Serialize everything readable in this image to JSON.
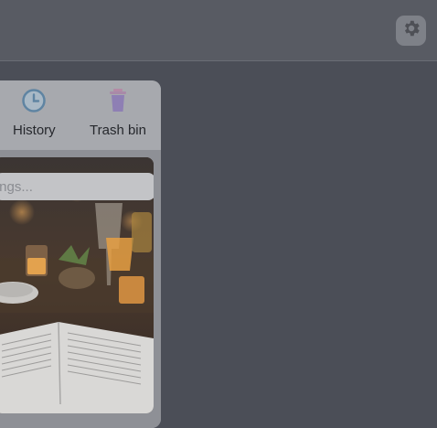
{
  "header": {
    "settings_icon": "gear-icon"
  },
  "tabs": [
    {
      "label": "History",
      "icon": "clock-icon",
      "color": "#6a8ca6"
    },
    {
      "label": "Trash bin",
      "icon": "trash-bin-icon",
      "color": "#8a7aa8"
    }
  ],
  "search": {
    "placeholder": "okings..."
  },
  "colors": {
    "background": "#4b4e57",
    "topbar": "#585b63",
    "panel": "#a7a9ae"
  }
}
